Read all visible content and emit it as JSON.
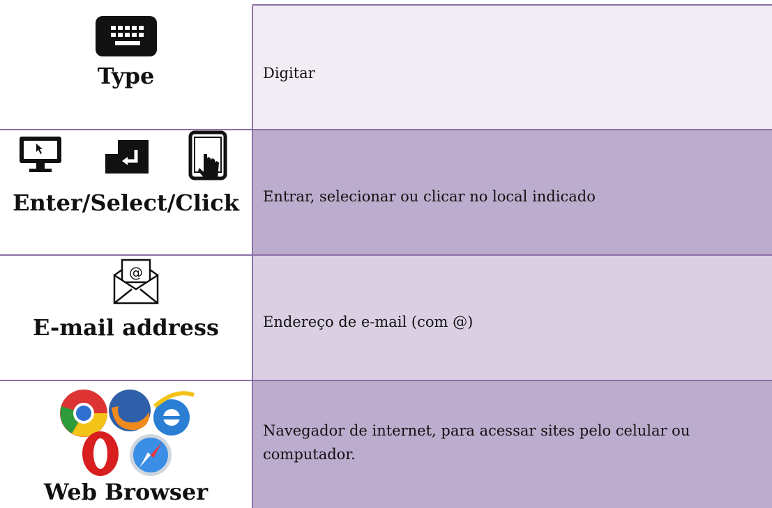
{
  "rows": [
    {
      "label": "Type",
      "description": "Digitar",
      "icons": [
        "keyboard-icon"
      ]
    },
    {
      "label": "Enter/Select/Click",
      "description": "Entrar, selecionar ou clicar no local indicado",
      "icons": [
        "monitor-cursor-icon",
        "enter-key-icon",
        "tablet-touch-icon"
      ]
    },
    {
      "label": "E-mail address",
      "description": "Endereço de e-mail (com @)",
      "icons": [
        "envelope-at-icon"
      ]
    },
    {
      "label": "Web Browser",
      "description": "Navegador de internet, para acessar sites pelo celular ou computador.",
      "icons": [
        "chrome-icon",
        "firefox-icon",
        "internet-explorer-icon",
        "opera-icon",
        "safari-icon"
      ]
    }
  ],
  "colors": {
    "border": "#8b6fa6",
    "row1_bg": "#f2edf4",
    "row2_bg": "#bcaccd",
    "row3_bg": "#dbd0e3",
    "row4_bg": "#bcaccd"
  }
}
